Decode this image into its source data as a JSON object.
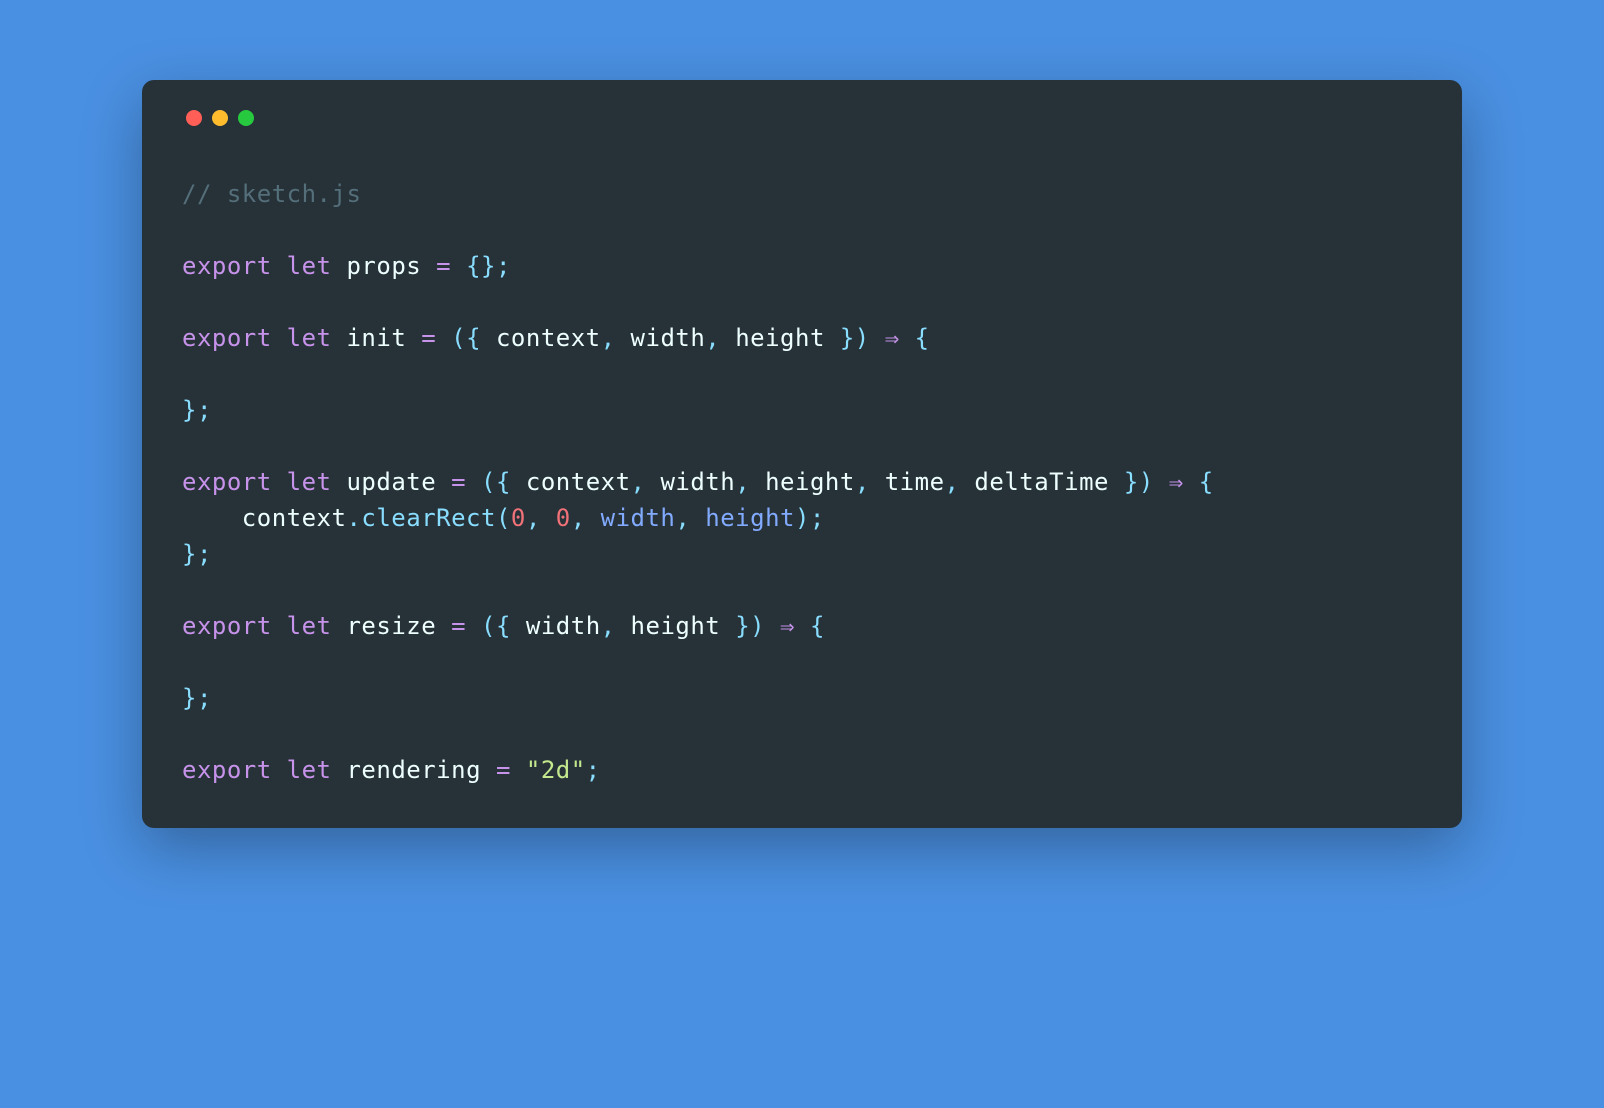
{
  "window_controls": {
    "close": "close",
    "minimize": "minimize",
    "maximize": "maximize"
  },
  "code": {
    "comment_prefix": "// ",
    "filename": "sketch.js",
    "kw_export": "export",
    "kw_let": "let",
    "var_props": "props",
    "eq": " = ",
    "empty_obj": "{};",
    "var_init": "init",
    "open_destruct": "({ ",
    "p_context": "context",
    "comma": ", ",
    "p_width": "width",
    "p_height": "height",
    "close_destruct": " })",
    "arrow": " ⇒ ",
    "open_brace": "{",
    "close_block": "};",
    "var_update": "update",
    "p_time": "time",
    "p_deltaTime": "deltaTime",
    "indent": "    ",
    "ctx": "context",
    "dot": ".",
    "m_clearRect": "clearRect",
    "lparen": "(",
    "zero": "0",
    "rparen_semi": ");",
    "var_resize": "resize",
    "var_rendering": "rendering",
    "str_2d": "\"2d\"",
    "semi": ";"
  }
}
